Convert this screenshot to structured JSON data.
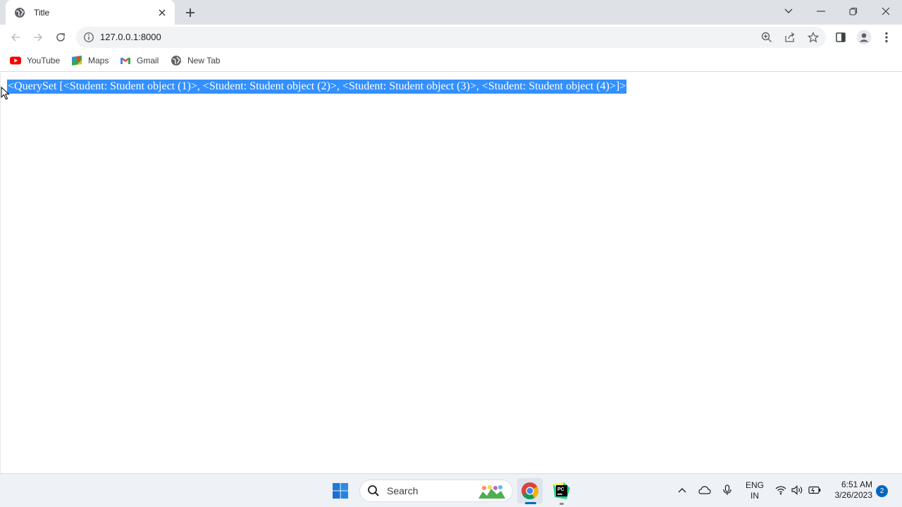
{
  "browser": {
    "tab": {
      "title": "Title",
      "favicon": "globe-icon"
    },
    "address": {
      "url": "127.0.0.1:8000"
    },
    "bookmarks": [
      {
        "label": "YouTube",
        "icon": "youtube-icon"
      },
      {
        "label": "Maps",
        "icon": "maps-icon"
      },
      {
        "label": "Gmail",
        "icon": "gmail-icon"
      },
      {
        "label": "New Tab",
        "icon": "globe-icon"
      }
    ]
  },
  "page": {
    "text": "<QuerySet [<Student: Student object (1)>, <Student: Student object (2)>, <Student: Student object (3)>, <Student: Student object (4)>]>",
    "selection_color": "#3390ff"
  },
  "taskbar": {
    "search_label": "Search",
    "lang_line1": "ENG",
    "lang_line2": "IN",
    "time": "6:51 AM",
    "date": "3/26/2023",
    "notification_count": "2",
    "accent": "#0067c0"
  }
}
